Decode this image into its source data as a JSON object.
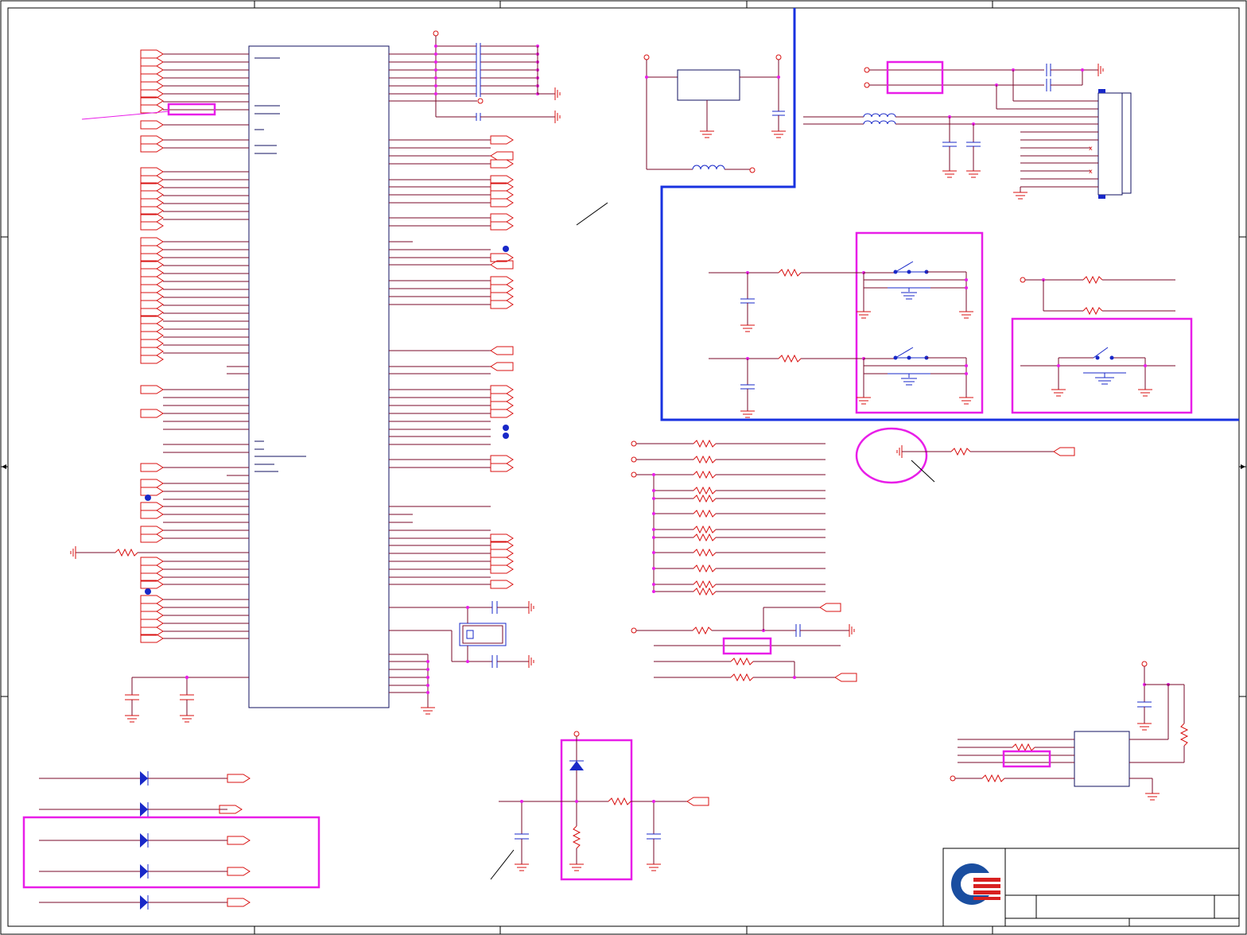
{
  "sheet": {
    "width": 1568,
    "height": 1176,
    "printed_text": []
  },
  "regions": {
    "main_ic": "main-ic-body",
    "voltage_regulator": "regulator-block",
    "connector": "connector-block",
    "switch_group_a": "switch-group-a",
    "switch_group_b": "switch-group-b",
    "resistor_bank": "resistor-bank",
    "crystal": "crystal-oscillator",
    "led_diodes": "diode-bank",
    "protection_circuit": "protection-circuit",
    "small_ic": "small-ic",
    "title_block": "title-block"
  },
  "colors": {
    "wire": "#7a0a2a",
    "component": "#d81010",
    "blue_part": "#1828c8",
    "zone_border": "#1832e0",
    "highlight": "#e81ee8",
    "junction": "#e81ee8",
    "logo_blue": "#1a4ea0",
    "logo_red": "#d82020"
  },
  "icons": {
    "logo": "company-logo-icon"
  }
}
